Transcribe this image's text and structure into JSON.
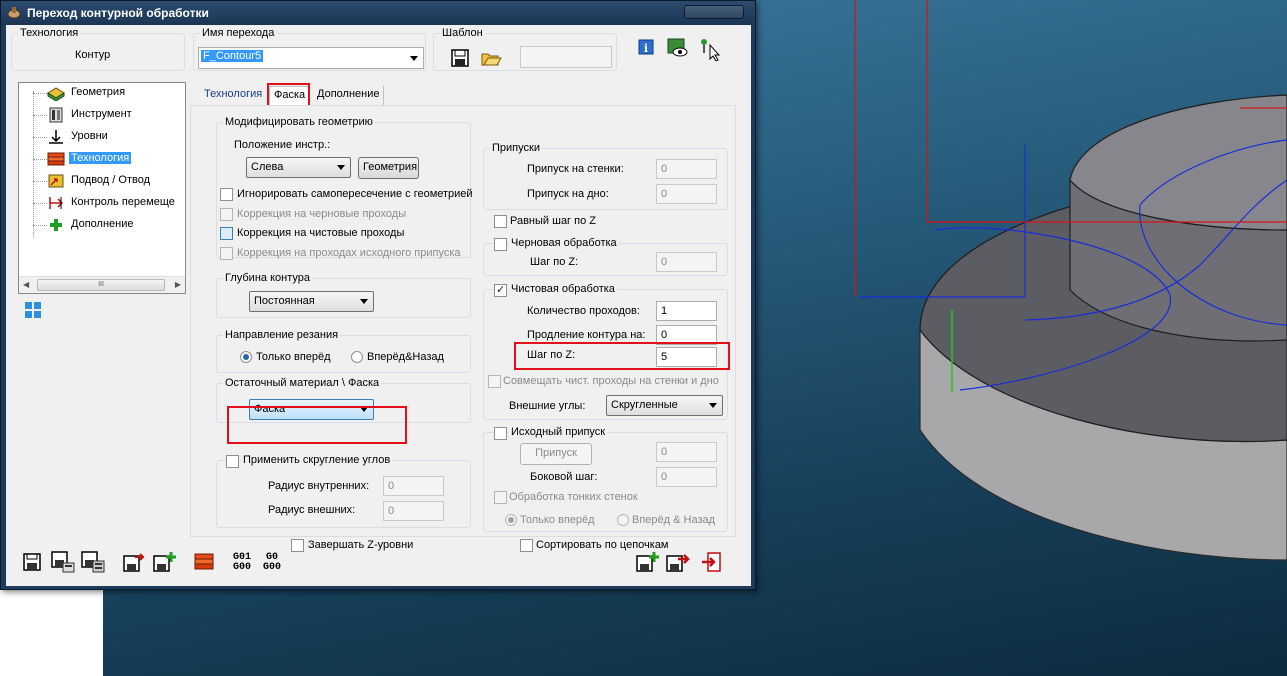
{
  "window": {
    "title": "Переход контурной обработки"
  },
  "technology": {
    "label": "Технология",
    "value": "Контур"
  },
  "transition_name": {
    "label": "Имя перехода",
    "value": "F_Contour5"
  },
  "template": {
    "label": "Шаблон",
    "value": ""
  },
  "tree": {
    "items": [
      {
        "label": "Геометрия",
        "icon": "geometry-icon"
      },
      {
        "label": "Инструмент",
        "icon": "tool-icon"
      },
      {
        "label": "Уровни",
        "icon": "levels-icon"
      },
      {
        "label": "Технология",
        "icon": "technology-icon",
        "selected": true
      },
      {
        "label": "Подвод / Отвод",
        "icon": "approach-icon"
      },
      {
        "label": "Контроль перемеще",
        "icon": "motion-control-icon"
      },
      {
        "label": "Дополнение",
        "icon": "plus-icon"
      }
    ],
    "scroll_thumb": "III"
  },
  "tabs": [
    {
      "label": "Технология",
      "active": false
    },
    {
      "label": "Фаска",
      "active": true
    },
    {
      "label": "Дополнение",
      "active": false
    }
  ],
  "modify_geometry": {
    "title": "Модифицировать геометрию",
    "tool_position_label": "Положение инстр.:",
    "tool_position_value": "Слева",
    "geometry_button": "Геометрия",
    "ignore_self_intersection": "Игнорировать самопересечение с геометрией",
    "correction_rough": "Коррекция на черновые проходы",
    "correction_finish": "Коррекция на чистовые проходы",
    "correction_initial": "Коррекция на проходах исходного припуска"
  },
  "contour_depth": {
    "title": "Глубина контура",
    "value": "Постоянная"
  },
  "cut_direction": {
    "title": "Направление резания",
    "option1": "Только вперёд",
    "option2": "Вперёд&Назад"
  },
  "remaining_material": {
    "title": "Остаточный материал \\ Фаска",
    "value": "Фаска"
  },
  "corner_rounding": {
    "title": "Применить скругление углов",
    "inner_radius_label": "Радиус внутренних:",
    "inner_radius_value": "0",
    "outer_radius_label": "Радиус внешних:",
    "outer_radius_value": "0"
  },
  "finish_z_levels": "Завершать Z-уровни",
  "allowances": {
    "title": "Припуски",
    "wall_label": "Припуск на стенки:",
    "wall_value": "0",
    "floor_label": "Припуск на дно:",
    "floor_value": "0"
  },
  "equal_z_step": "Равный шаг по Z",
  "rough": {
    "title": "Черновая обработка",
    "z_step_label": "Шаг по Z:",
    "z_step_value": "0"
  },
  "finish": {
    "title": "Чистовая обработка",
    "passes_label": "Количество проходов:",
    "passes_value": "1",
    "extension_label": "Продление контура на:",
    "extension_value": "0",
    "z_step_label": "Шаг по Z:",
    "z_step_value": "5",
    "combine_label": "Совмещать чист. проходы на стенки и дно",
    "outer_corners_label": "Внешние углы:",
    "outer_corners_value": "Скругленные"
  },
  "initial_allowance": {
    "title": "Исходный припуск",
    "button": "Припуск",
    "button_value": "0",
    "side_step_label": "Боковой шаг:",
    "side_step_value": "0",
    "thin_walls": "Обработка тонких стенок",
    "option1": "Только вперёд",
    "option2": "Вперёд & Назад"
  },
  "sort_chains": "Сортировать по цепочкам",
  "bottom_toolbar": {
    "g_codes_a": "G01\nG00",
    "g_codes_b": "G0\nG00"
  },
  "colors": {
    "highlight_red": "#e3101a",
    "selection_blue": "#3399ff",
    "tab_blue": "#1a3e8c"
  }
}
